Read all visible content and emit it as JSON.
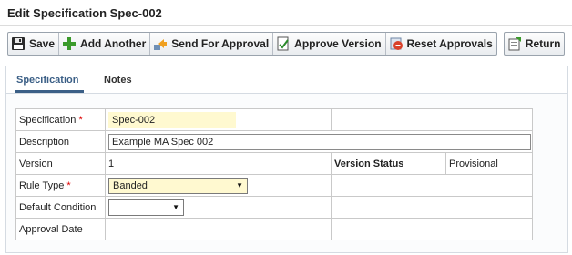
{
  "page": {
    "title": "Edit Specification Spec-002"
  },
  "toolbar": {
    "save_label": "Save",
    "add_another_label": "Add Another",
    "send_for_approval_label": "Send For Approval",
    "approve_version_label": "Approve Version",
    "reset_approvals_label": "Reset Approvals",
    "return_label": "Return"
  },
  "tabs": {
    "specification": "Specification",
    "notes": "Notes"
  },
  "form": {
    "specification_label": "Specification",
    "required_mark": "*",
    "specification_value": "Spec-002",
    "description_label": "Description",
    "description_value": "Example MA Spec 002",
    "version_label": "Version",
    "version_value": "1",
    "version_status_label": "Version Status",
    "version_status_value": "Provisional",
    "rule_type_label": "Rule Type",
    "rule_type_value": "Banded",
    "default_condition_label": "Default Condition",
    "default_condition_value": "",
    "approval_date_label": "Approval Date",
    "approval_date_value": ""
  },
  "icons": {
    "save": "floppy-disk-icon",
    "add_another": "green-plus-icon",
    "send_for_approval": "send-arrow-icon",
    "approve_version": "approve-document-icon",
    "reset_approvals": "reset-icon",
    "return": "return-document-icon"
  },
  "colors": {
    "required": "#dd0000",
    "active_tab": "#3b5f86",
    "highlight_field": "#fff9d0"
  }
}
